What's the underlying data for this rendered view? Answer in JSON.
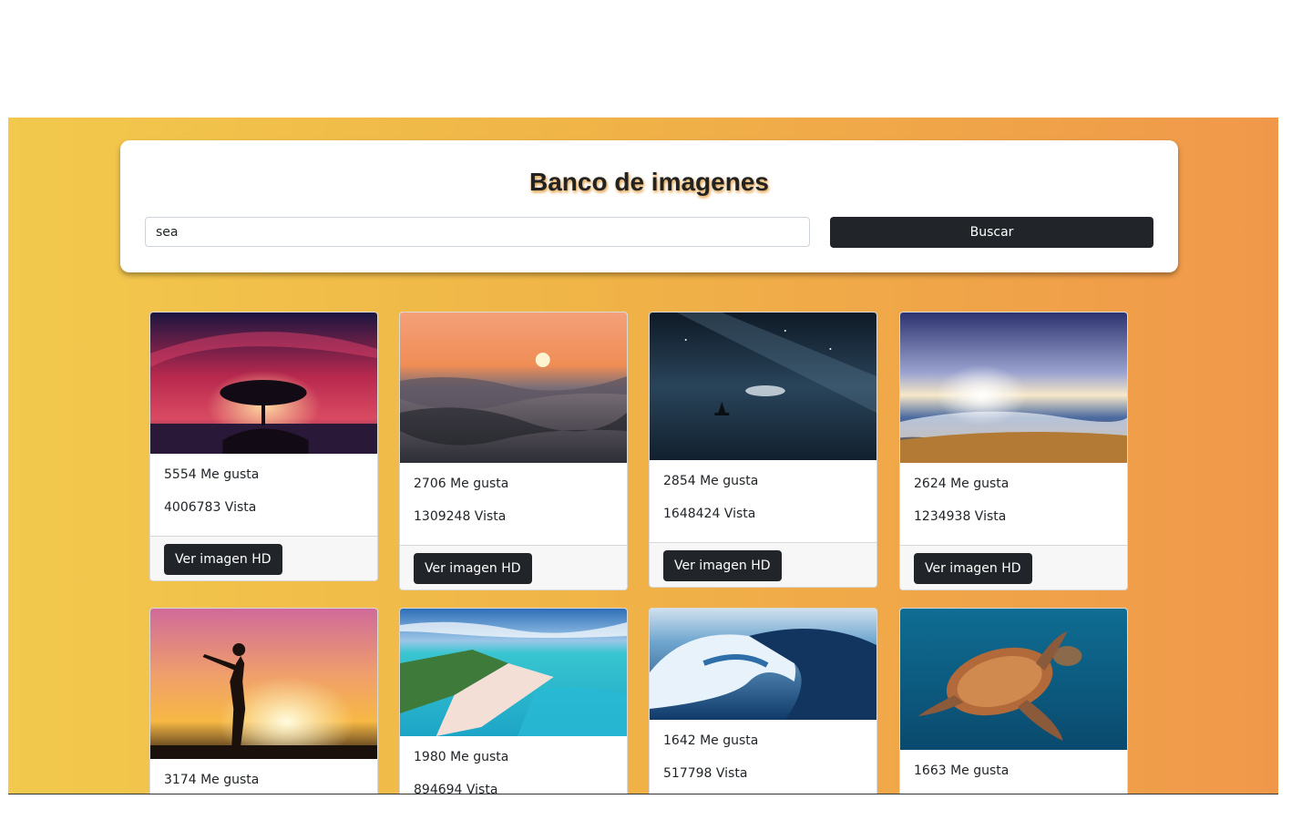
{
  "header": {
    "title": "Banco de imagenes",
    "search_value": "sea",
    "search_button_label": "Buscar"
  },
  "theme": {
    "gradient_start": "#f2c94c",
    "gradient_end": "#f0984a",
    "button_color": "#212529"
  },
  "cards": [
    {
      "likes": "5554 Me gusta",
      "views": "4006783 Vista",
      "button_label": "Ver imagen HD",
      "image": "tree-sunset-image"
    },
    {
      "likes": "2706 Me gusta",
      "views": "1309248 Vista",
      "button_label": "Ver imagen HD",
      "image": "ocean-sunset-image"
    },
    {
      "likes": "2854 Me gusta",
      "views": "1648424 Vista",
      "button_label": "Ver imagen HD",
      "image": "night-sea-boat-image"
    },
    {
      "likes": "2624 Me gusta",
      "views": "1234938 Vista",
      "button_label": "Ver imagen HD",
      "image": "beach-sunrise-image"
    },
    {
      "likes": "3174 Me gusta",
      "views": "",
      "button_label": "",
      "image": "woman-silhouette-sunset-image"
    },
    {
      "likes": "1980 Me gusta",
      "views": "894694 Vista",
      "button_label": "",
      "image": "tropical-island-image"
    },
    {
      "likes": "1642 Me gusta",
      "views": "517798 Vista",
      "button_label": "",
      "image": "wave-image"
    },
    {
      "likes": "1663 Me gusta",
      "views": "",
      "button_label": "",
      "image": "sea-turtle-image"
    }
  ]
}
